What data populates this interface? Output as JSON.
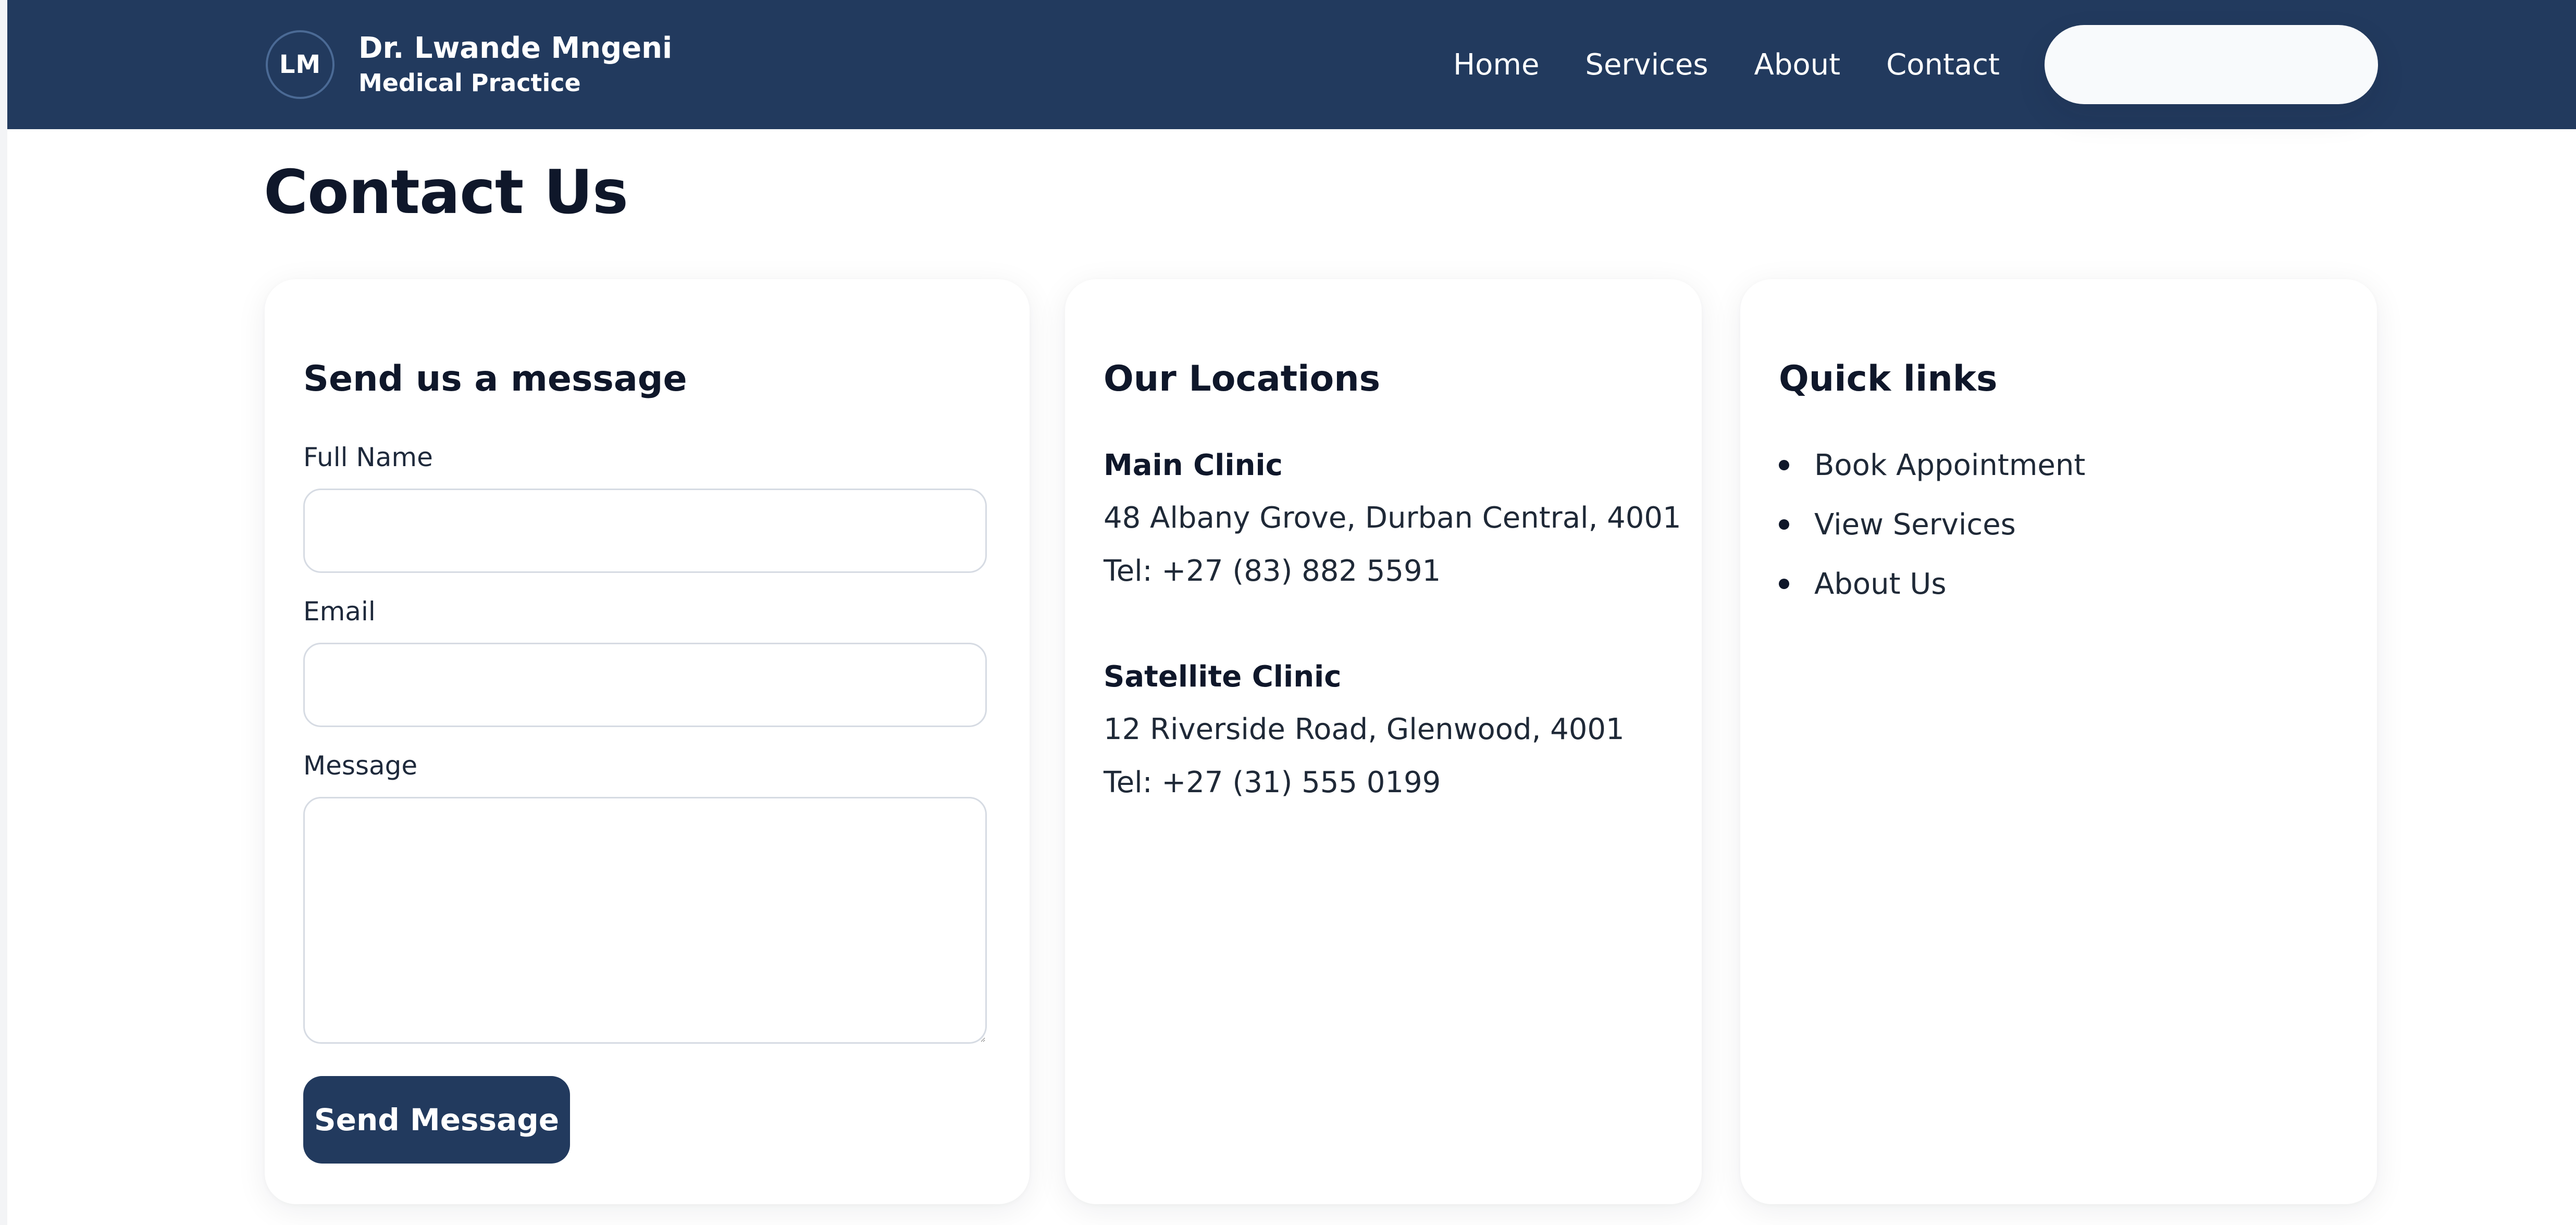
{
  "header": {
    "logo_initials": "LM",
    "brand_name": "Dr. Lwande Mngeni",
    "brand_subtitle": "Medical Practice",
    "nav": [
      {
        "label": "Home"
      },
      {
        "label": "Services"
      },
      {
        "label": "About"
      },
      {
        "label": "Contact"
      }
    ]
  },
  "page": {
    "title": "Contact Us"
  },
  "form": {
    "title": "Send us a message",
    "full_name_label": "Full Name",
    "full_name_value": "",
    "email_label": "Email",
    "email_value": "",
    "message_label": "Message",
    "message_value": "",
    "submit_label": "Send Message"
  },
  "locations": {
    "title": "Our Locations",
    "items": [
      {
        "name": "Main Clinic",
        "address": "48 Albany Grove, Durban Central, 4001",
        "tel": "Tel: +27 (83) 882 5591"
      },
      {
        "name": "Satellite Clinic",
        "address": "12 Riverside Road, Glenwood, 4001",
        "tel": "Tel: +27 (31) 555 0199"
      }
    ]
  },
  "quick_links": {
    "title": "Quick links",
    "items": [
      {
        "label": "Book Appointment"
      },
      {
        "label": "View Services"
      },
      {
        "label": "About Us"
      }
    ]
  },
  "colors": {
    "header_bg": "#223a5e",
    "button_bg": "#223a5e",
    "text_primary": "#0f172a",
    "page_bg": "#ffffff"
  }
}
